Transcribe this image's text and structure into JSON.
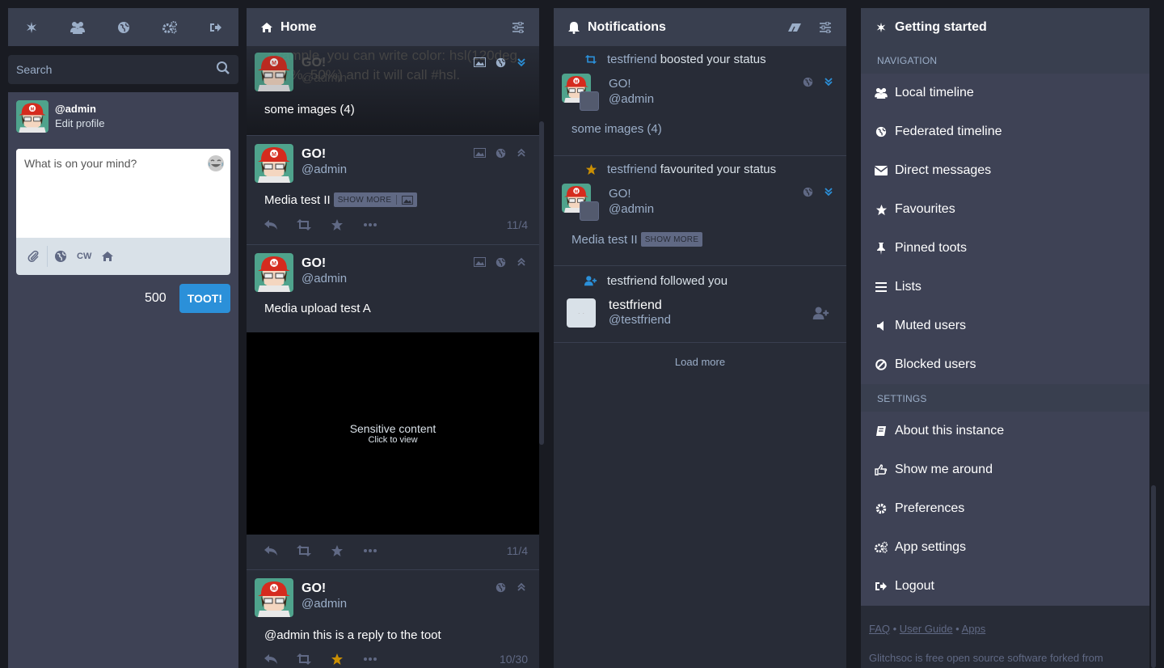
{
  "colors": {
    "accent": "#2b90d9",
    "favourite": "#ca8f04",
    "bg": "#191b22",
    "column": "#282c37",
    "panel": "#3e4255"
  },
  "drawer_nav": [
    "getting-started-icon",
    "local-timeline-icon",
    "federated-timeline-icon",
    "preferences-icon",
    "logout-icon"
  ],
  "search": {
    "placeholder": "Search"
  },
  "account": {
    "handle": "@admin",
    "edit_label": "Edit profile"
  },
  "compose": {
    "placeholder": "What is on your mind?",
    "cw_label": "CW",
    "char_count": "500",
    "submit_label": "TOOT!"
  },
  "home": {
    "title": "Home",
    "statuses": [
      {
        "display_name": "GO!",
        "username": "@admin",
        "content": "some images (4)",
        "overlay_text": "example, you can write color: hsl(120deg, 100%, 50%) and it will call #hsl."
      },
      {
        "display_name": "GO!",
        "username": "@admin",
        "content": "Media test II",
        "show_more": "SHOW MORE",
        "time": "11/4"
      },
      {
        "display_name": "GO!",
        "username": "@admin",
        "content": "Media upload test A",
        "sensitive_title": "Sensitive content",
        "sensitive_sub": "Click to view",
        "time": "11/4"
      },
      {
        "display_name": "GO!",
        "username": "@admin",
        "content": "@admin this is a reply to the toot",
        "time": "10/30"
      }
    ]
  },
  "notifications": {
    "title": "Notifications",
    "items": [
      {
        "who": "testfriend",
        "what": "boosted your status",
        "display_name": "GO!",
        "username": "@admin",
        "content": "some images (4)"
      },
      {
        "who": "testfriend",
        "what": "favourited your status",
        "display_name": "GO!",
        "username": "@admin",
        "content": "Media test II",
        "show_more": "SHOW MORE"
      },
      {
        "who": "testfriend",
        "what": "followed you",
        "display_name": "testfriend",
        "username": "@testfriend"
      }
    ],
    "load_more": "Load more"
  },
  "getting_started": {
    "title": "Getting started",
    "navigation_label": "NAVIGATION",
    "nav_items": [
      "Local timeline",
      "Federated timeline",
      "Direct messages",
      "Favourites",
      "Pinned toots",
      "Lists",
      "Muted users",
      "Blocked users"
    ],
    "settings_label": "SETTINGS",
    "settings_items": [
      "About this instance",
      "Show me around",
      "Preferences",
      "App settings",
      "Logout"
    ],
    "footer_links": [
      "FAQ",
      "User Guide",
      "Apps"
    ],
    "footer_text": "Glitchsoc is free open source software forked from"
  }
}
